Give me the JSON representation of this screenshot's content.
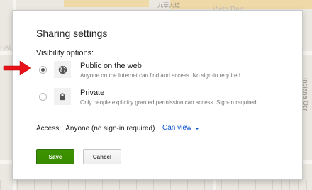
{
  "map": {
    "labels": [
      "九華大道",
      "Victo Dart",
      "PAL",
      "Indiana Ocr"
    ]
  },
  "dialog": {
    "title": "Sharing settings",
    "visibility_label": "Visibility options:",
    "options": [
      {
        "title": "Public on the web",
        "description": "Anyone on the Internet can find and access. No sign-in required.",
        "icon": "globe-icon",
        "selected": true
      },
      {
        "title": "Private",
        "description": "Only people explicitly granted permission can access. Sign-in required.",
        "icon": "lock-icon",
        "selected": false
      }
    ],
    "access": {
      "label": "Access:",
      "value": "Anyone (no sign-in required)",
      "permission": "Can view"
    },
    "buttons": {
      "save": "Save",
      "cancel": "Cancel"
    }
  },
  "colors": {
    "save_green": "#3d9400",
    "link_blue": "#1155cc",
    "arrow_red": "#e8121a"
  }
}
